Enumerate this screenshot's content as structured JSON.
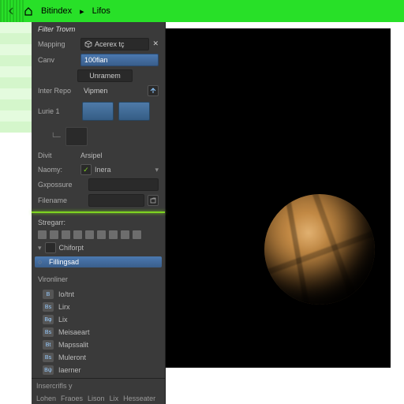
{
  "topbar": {
    "crumb1": "Bitindex",
    "crumb2": "Lifos"
  },
  "panel": {
    "title": "Filter Trovm",
    "rows": {
      "mapping_label": "Mapping",
      "mapping_value": "Acerex tç",
      "canv_label": "Canv",
      "canv_value": "100fian",
      "canv_button": "Unramem",
      "inter_label": "Inter Repo",
      "inter_value": "Vipmen",
      "lurie_label": "Lurie 1",
      "divit_label": "Divit",
      "divit_value": "Arsipel",
      "naomy_label": "Naomy:",
      "naomy_value": "Inera",
      "gfx_label": "Gxpossure",
      "filename_label": "Filename",
      "filename_value": ""
    },
    "section2": "Stregarr:",
    "checkbox_label": "Chiforpt",
    "selected_item": "Fillingsad",
    "tree_header": "Vironliner",
    "leaves": [
      {
        "k": "B",
        "t": "Io/tnt"
      },
      {
        "k": "Bs",
        "t": "Lirx"
      },
      {
        "k": "Bφ",
        "t": "Lix"
      },
      {
        "k": "Bs",
        "t": "Meisaeart"
      },
      {
        "k": "Bt",
        "t": "Mapssalit"
      },
      {
        "k": "Bs",
        "t": "Muleront"
      },
      {
        "k": "Bψ",
        "t": "Iaerner"
      }
    ],
    "footer": "Insercrifls y",
    "tabs": [
      "Lohen",
      "Fraoes",
      "Lison",
      "Lix",
      "Hesseater"
    ]
  }
}
